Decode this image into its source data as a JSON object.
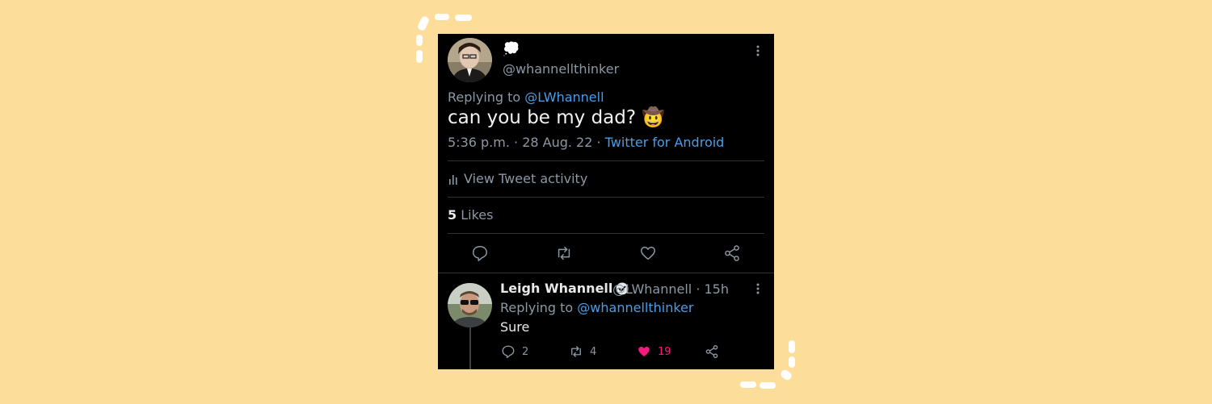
{
  "tweet": {
    "display_name_emoji": "💭",
    "handle": "@whannellthinker",
    "replying_prefix": "Replying to",
    "replying_to": "@LWhannell",
    "text": "can you be my dad? 🤠",
    "time_date": "5:36 p.m. · 28 Aug. 22 ·",
    "source": "Twitter for Android",
    "activity_label": "View Tweet activity",
    "likes_count": "5",
    "likes_label": "Likes"
  },
  "reply": {
    "name": "Leigh Whannell",
    "handle_time": "@LWhannell · 15h",
    "replying_prefix": "Replying to",
    "replying_to": "@whannellthinker",
    "text": "Sure",
    "stats": {
      "replies": "2",
      "retweets": "4",
      "likes": "19"
    }
  },
  "icons": {
    "more": "more-vertical-icon",
    "reply": "reply-icon",
    "retweet": "retweet-icon",
    "like": "heart-icon",
    "share": "share-icon",
    "activity": "bar-chart-icon",
    "verified": "verified-badge-icon"
  },
  "colors": {
    "background": "#fddd9a",
    "card": "#000000",
    "link": "#4a9ee8",
    "muted": "#8b98a5",
    "like_active": "#f91880"
  }
}
